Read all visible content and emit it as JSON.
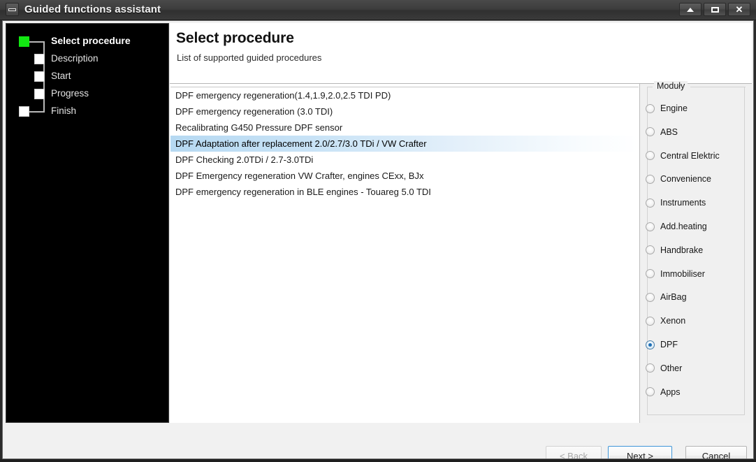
{
  "window": {
    "title": "Guided functions assistant",
    "system_icon": "window-restore-icon",
    "controls": [
      {
        "name": "minimize-button",
        "glyph": "up-arrow"
      },
      {
        "name": "maximize-button",
        "glyph": "square"
      },
      {
        "name": "close-button",
        "glyph": "X"
      }
    ]
  },
  "sidebar": {
    "steps": [
      {
        "label": "Select procedure",
        "state": "current"
      },
      {
        "label": "Description",
        "state": "pending"
      },
      {
        "label": "Start",
        "state": "pending"
      },
      {
        "label": "Progress",
        "state": "pending"
      },
      {
        "label": "Finish",
        "state": "pending"
      }
    ],
    "current_color": "#12e712",
    "pending_color": "#ffffff",
    "background": "#000000"
  },
  "header": {
    "title": "Select procedure",
    "subtitle": "List of supported guided procedures"
  },
  "procedures": {
    "items": [
      "DPF emergency regeneration(1.4,1.9,2.0,2.5 TDI PD)",
      "DPF emergency regeneration (3.0 TDI)",
      "Recalibrating G450 Pressure DPF sensor",
      "DPF Adaptation after replacement 2.0/2.7/3.0 TDi / VW Crafter",
      "DPF Checking 2.0TDi / 2.7-3.0TDi",
      "DPF Emergency regeneration VW Crafter, engines CExx, BJx",
      "DPF emergency regeneration in BLE engines - Touareg 5.0 TDI"
    ],
    "selected_index": 3,
    "selection_color": "#b6d9f2"
  },
  "modules": {
    "group_label": "Moduły",
    "selected": "DPF",
    "accent_color": "#1f6fb5",
    "options": [
      "Engine",
      "ABS",
      "Central Elektric",
      "Convenience",
      "Instruments",
      "Add.heating",
      "Handbrake",
      "Immobiliser",
      "AirBag",
      "Xenon",
      "DPF",
      "Other",
      "Apps"
    ]
  },
  "footer": {
    "back": {
      "prefix": "< ",
      "mnemonic": "B",
      "rest": "ack",
      "disabled": true
    },
    "next": {
      "prefix": "",
      "mnemonic": "N",
      "rest": "ext >",
      "focused": true
    },
    "cancel": {
      "label": "Cancel"
    }
  }
}
